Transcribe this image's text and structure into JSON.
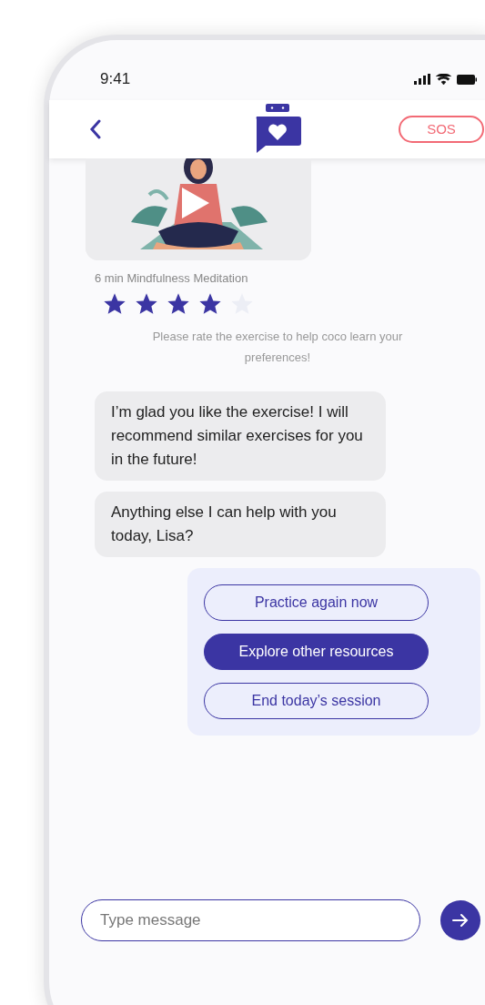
{
  "status_bar": {
    "time": "9:41"
  },
  "header": {
    "sos_label": "SOS"
  },
  "exercise": {
    "kind": "picture",
    "caption": "6 min Mindfulness Meditation",
    "stars": 4
  },
  "rating_prompt": "Please rate the exercise to help coco learn your preferences!",
  "messages": [
    {
      "text": "I’m glad you like the exercise! I will recommend similar exercises for you in the future!"
    },
    {
      "text": "Anything else I can help with you today, Lisa?"
    }
  ],
  "options": [
    {
      "label": "Practice again now",
      "selected": false
    },
    {
      "label": "Explore other resources",
      "selected": true
    },
    {
      "label": "End today’s session",
      "selected": false
    }
  ],
  "composer": {
    "placeholder": "Type message"
  }
}
